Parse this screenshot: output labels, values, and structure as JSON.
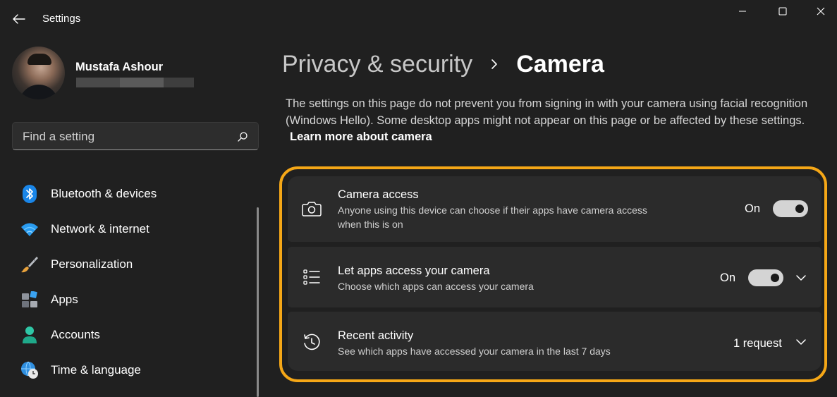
{
  "app": {
    "title": "Settings"
  },
  "profile": {
    "name": "Mustafa Ashour"
  },
  "search": {
    "placeholder": "Find a setting"
  },
  "sidebar": {
    "items": [
      {
        "label": "Bluetooth & devices",
        "icon": "bluetooth-icon"
      },
      {
        "label": "Network & internet",
        "icon": "wifi-icon"
      },
      {
        "label": "Personalization",
        "icon": "brush-icon"
      },
      {
        "label": "Apps",
        "icon": "apps-icon"
      },
      {
        "label": "Accounts",
        "icon": "person-icon"
      },
      {
        "label": "Time & language",
        "icon": "globe-clock-icon"
      }
    ]
  },
  "breadcrumb": {
    "parent": "Privacy & security",
    "current": "Camera"
  },
  "description": {
    "text": "The settings on this page do not prevent you from signing in with your camera using facial recognition (Windows Hello). Some desktop apps might not appear on this page or be affected by these settings.",
    "link": "Learn more about camera"
  },
  "settings": [
    {
      "title": "Camera access",
      "subtitle": "Anyone using this device can choose if their apps have camera access when this is on",
      "state": "On",
      "icon": "camera-icon"
    },
    {
      "title": "Let apps access your camera",
      "subtitle": "Choose which apps can access your camera",
      "state": "On",
      "icon": "list-icon"
    },
    {
      "title": "Recent activity",
      "subtitle": "See which apps have accessed your camera in the last 7 days",
      "state": "1 request",
      "icon": "history-icon"
    }
  ],
  "colors": {
    "background": "#202020",
    "card": "#2b2b2b",
    "highlight": "#f5a717",
    "accent": "#4cc2ff"
  }
}
